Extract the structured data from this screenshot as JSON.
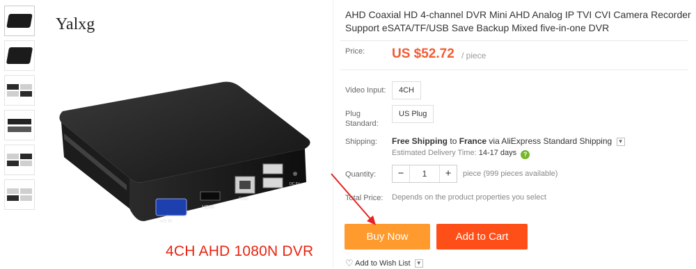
{
  "gallery": {
    "thumbnails": [
      "thumb-1",
      "thumb-2",
      "thumb-3",
      "thumb-4",
      "thumb-5",
      "thumb-6"
    ],
    "brand": "Yalxg",
    "caption": "4CH AHD 1080N DVR",
    "device_labels": {
      "vga": "A/V IN",
      "hdmi": "HDMI",
      "rj45": "RJ45",
      "power": "DC 5V"
    }
  },
  "product": {
    "title": "AHD Coaxial HD 4-channel DVR Mini AHD Analog IP TVI CVI Camera Recorder Support eSATA/TF/USB Save Backup Mixed five-in-one DVR"
  },
  "price": {
    "label": "Price:",
    "value": "US $52.72",
    "unit": "/ piece"
  },
  "video_input": {
    "label": "Video Input:",
    "option": "4CH"
  },
  "plug": {
    "label": "Plug Standard:",
    "label_line1": "Plug",
    "label_line2": "Standard:",
    "option": "US Plug"
  },
  "shipping": {
    "label": "Shipping:",
    "free": "Free Shipping",
    "to": "to",
    "country": "France",
    "via": "via AliExpress Standard Shipping",
    "estimate_label": "Estimated Delivery Time:",
    "estimate_days": "14-17 days",
    "help_icon": "question-icon",
    "dropdown_icon": "chevron-down-icon"
  },
  "quantity": {
    "label": "Quantity:",
    "minus": "−",
    "value": "1",
    "plus": "+",
    "availability": "piece (999 pieces available)"
  },
  "total": {
    "label": "Total Price:",
    "text": "Depends on the product properties you select"
  },
  "actions": {
    "buy_now": "Buy Now",
    "add_to_cart": "Add to Cart",
    "wish_list": "Add to Wish List"
  },
  "colors": {
    "price": "#f25a32",
    "buy_now": "#ff9a2e",
    "add_to_cart": "#ff4f19",
    "caption": "#e8230e",
    "arrow": "#e52222",
    "help": "#74b728"
  }
}
